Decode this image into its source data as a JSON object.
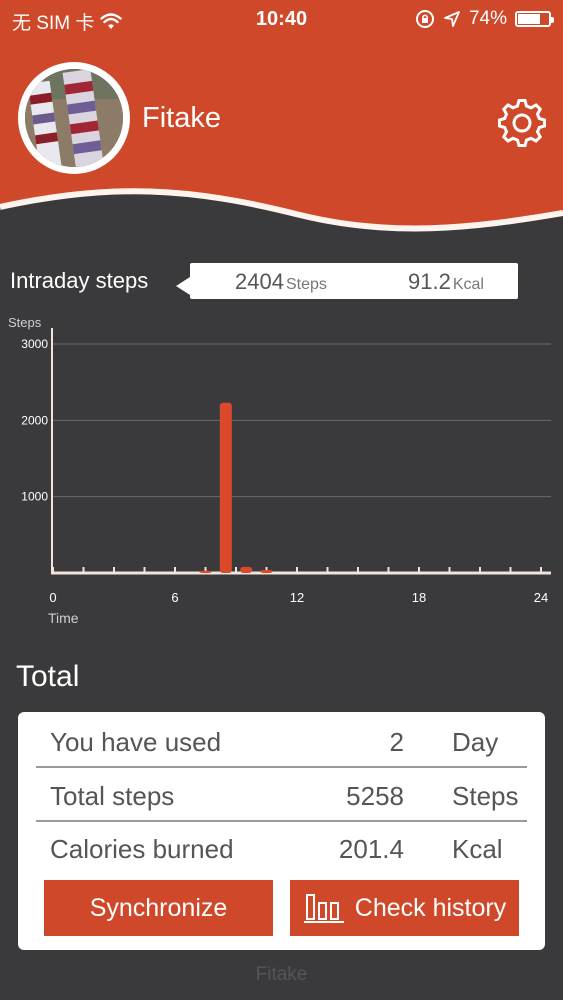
{
  "status_bar": {
    "carrier": "无 SIM 卡",
    "time": "10:40",
    "battery": "74%",
    "battery_level": 0.74,
    "icons": [
      "wifi-icon",
      "orientation-lock-icon",
      "location-icon",
      "battery-icon"
    ]
  },
  "header": {
    "app_name": "Fitake",
    "accent_color": "#d0482a"
  },
  "intraday": {
    "label": "Intraday steps",
    "steps_value": "2404",
    "steps_unit": "Steps",
    "kcal_value": "91.2",
    "kcal_unit": "Kcal"
  },
  "chart_data": {
    "type": "bar",
    "ylabel": "Steps",
    "xlabel": "Time",
    "ylim": [
      0,
      3000
    ],
    "xlim": [
      0,
      24
    ],
    "yticks": [
      "1000",
      "2000",
      "3000"
    ],
    "xticks": [
      "0",
      "6",
      "12",
      "18",
      "24"
    ],
    "grid": true,
    "x": [
      7.5,
      8.5,
      9.5,
      10.5
    ],
    "values": [
      30,
      2230,
      80,
      40
    ]
  },
  "total": {
    "title": "Total",
    "rows": [
      {
        "label": "You have used",
        "value": "2",
        "unit": "Day"
      },
      {
        "label": "Total steps",
        "value": "5258",
        "unit": "Steps"
      },
      {
        "label": "Calories burned",
        "value": "201.4",
        "unit": "Kcal"
      }
    ],
    "sync_label": "Synchronize",
    "history_label": "Check history"
  },
  "footer": {
    "text": "Fitake"
  }
}
